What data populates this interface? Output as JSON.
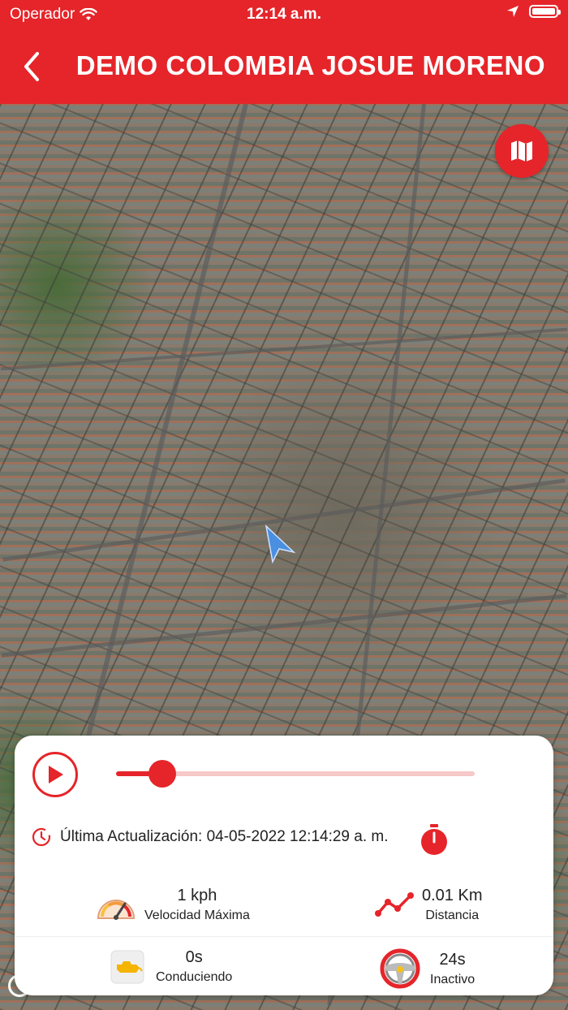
{
  "status_bar": {
    "carrier": "Operador",
    "time": "12:14 a.m."
  },
  "nav": {
    "title": "DEMO COLOMBIA JOSUE MORENO"
  },
  "colors": {
    "accent": "#e5252a",
    "track": "#f6c8c8"
  },
  "playback": {
    "progress": 0.13
  },
  "update": {
    "text": "Última Actualización: 04-05-2022 12:14:29 a. m."
  },
  "stats": {
    "max_speed": {
      "value": "1 kph",
      "label": "Velocidad Máxima",
      "icon": "speedometer-icon"
    },
    "distance": {
      "value": "0.01 Km",
      "label": "Distancia",
      "icon": "route-icon"
    },
    "driving": {
      "value": "0s",
      "label": "Conduciendo",
      "icon": "engine-icon"
    },
    "idle": {
      "value": "24s",
      "label": "Inactivo",
      "icon": "steering-wheel-icon"
    }
  }
}
